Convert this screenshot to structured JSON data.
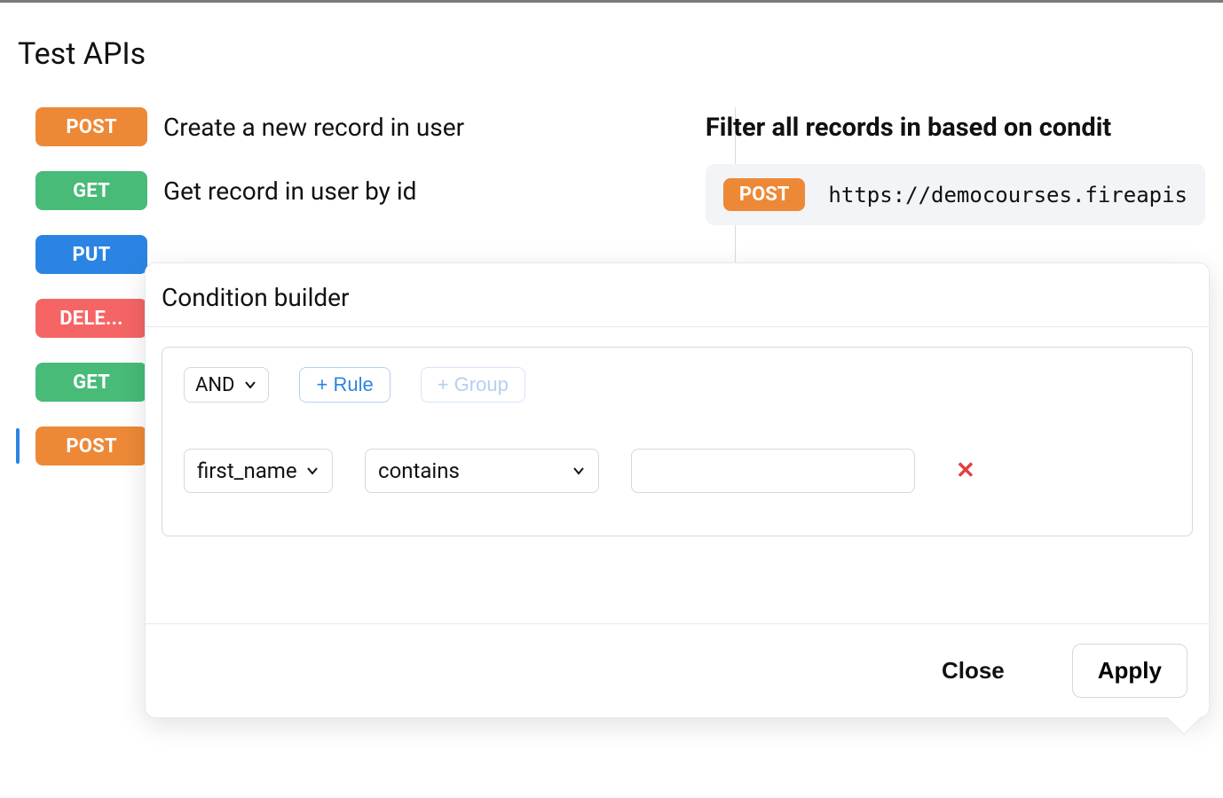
{
  "page": {
    "title": "Test APIs"
  },
  "api_list": [
    {
      "method": "POST",
      "method_badge_class": "post",
      "label": "Create a new record in user",
      "active": false
    },
    {
      "method": "GET",
      "method_badge_class": "get",
      "label": "Get record in user by id",
      "active": false
    },
    {
      "method": "PUT",
      "method_badge_class": "put",
      "label": "",
      "active": false
    },
    {
      "method": "DELE...",
      "method_badge_class": "delete",
      "label": "",
      "active": false
    },
    {
      "method": "GET",
      "method_badge_class": "get",
      "label": "",
      "active": false
    },
    {
      "method": "POST",
      "method_badge_class": "post",
      "label": "",
      "active": true
    }
  ],
  "right": {
    "title": "Filter all records in based on condit",
    "method_badge": "POST",
    "url": "https://democourses.fireapis"
  },
  "modal": {
    "title": "Condition builder",
    "combinator": "AND",
    "add_rule_label": "+ Rule",
    "add_group_label": "+ Group",
    "rule": {
      "field": "first_name",
      "operator": "contains",
      "value": ""
    },
    "close_label": "Close",
    "apply_label": "Apply"
  }
}
